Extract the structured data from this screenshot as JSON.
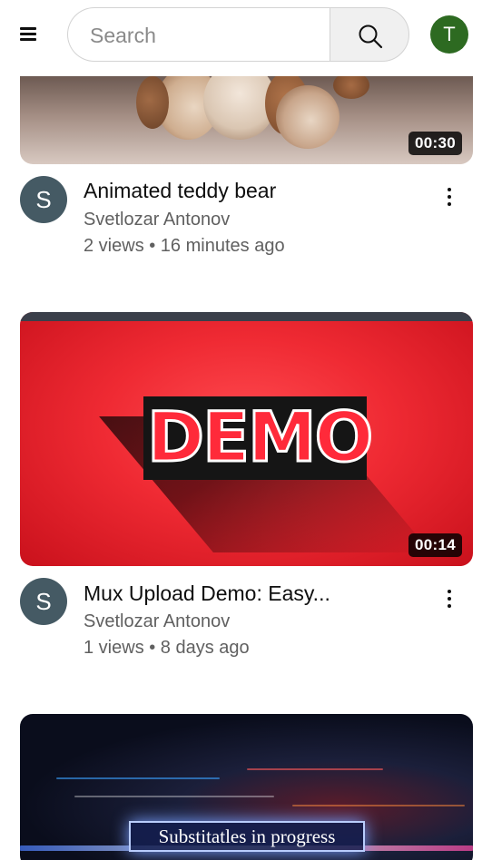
{
  "header": {
    "search_placeholder": "Search",
    "user_avatar_letter": "T",
    "user_avatar_color": "#2d6a21"
  },
  "videos": [
    {
      "title": "Animated teddy bear",
      "channel": "Svetlozar Antonov",
      "channel_avatar_letter": "S",
      "meta": "2 views • 16 minutes ago",
      "duration": "00:30"
    },
    {
      "title": "Mux Upload Demo: Easy...",
      "channel": "Svetlozar Antonov",
      "channel_avatar_letter": "S",
      "meta": "1 views • 8 days ago",
      "duration": "00:14",
      "thumbnail_text": "DEMO"
    },
    {
      "thumbnail_text": "Substitatles in progress"
    }
  ],
  "colors": {
    "channel_avatar": "#455a64",
    "text_primary": "#0f0f0f",
    "text_secondary": "#606060"
  }
}
